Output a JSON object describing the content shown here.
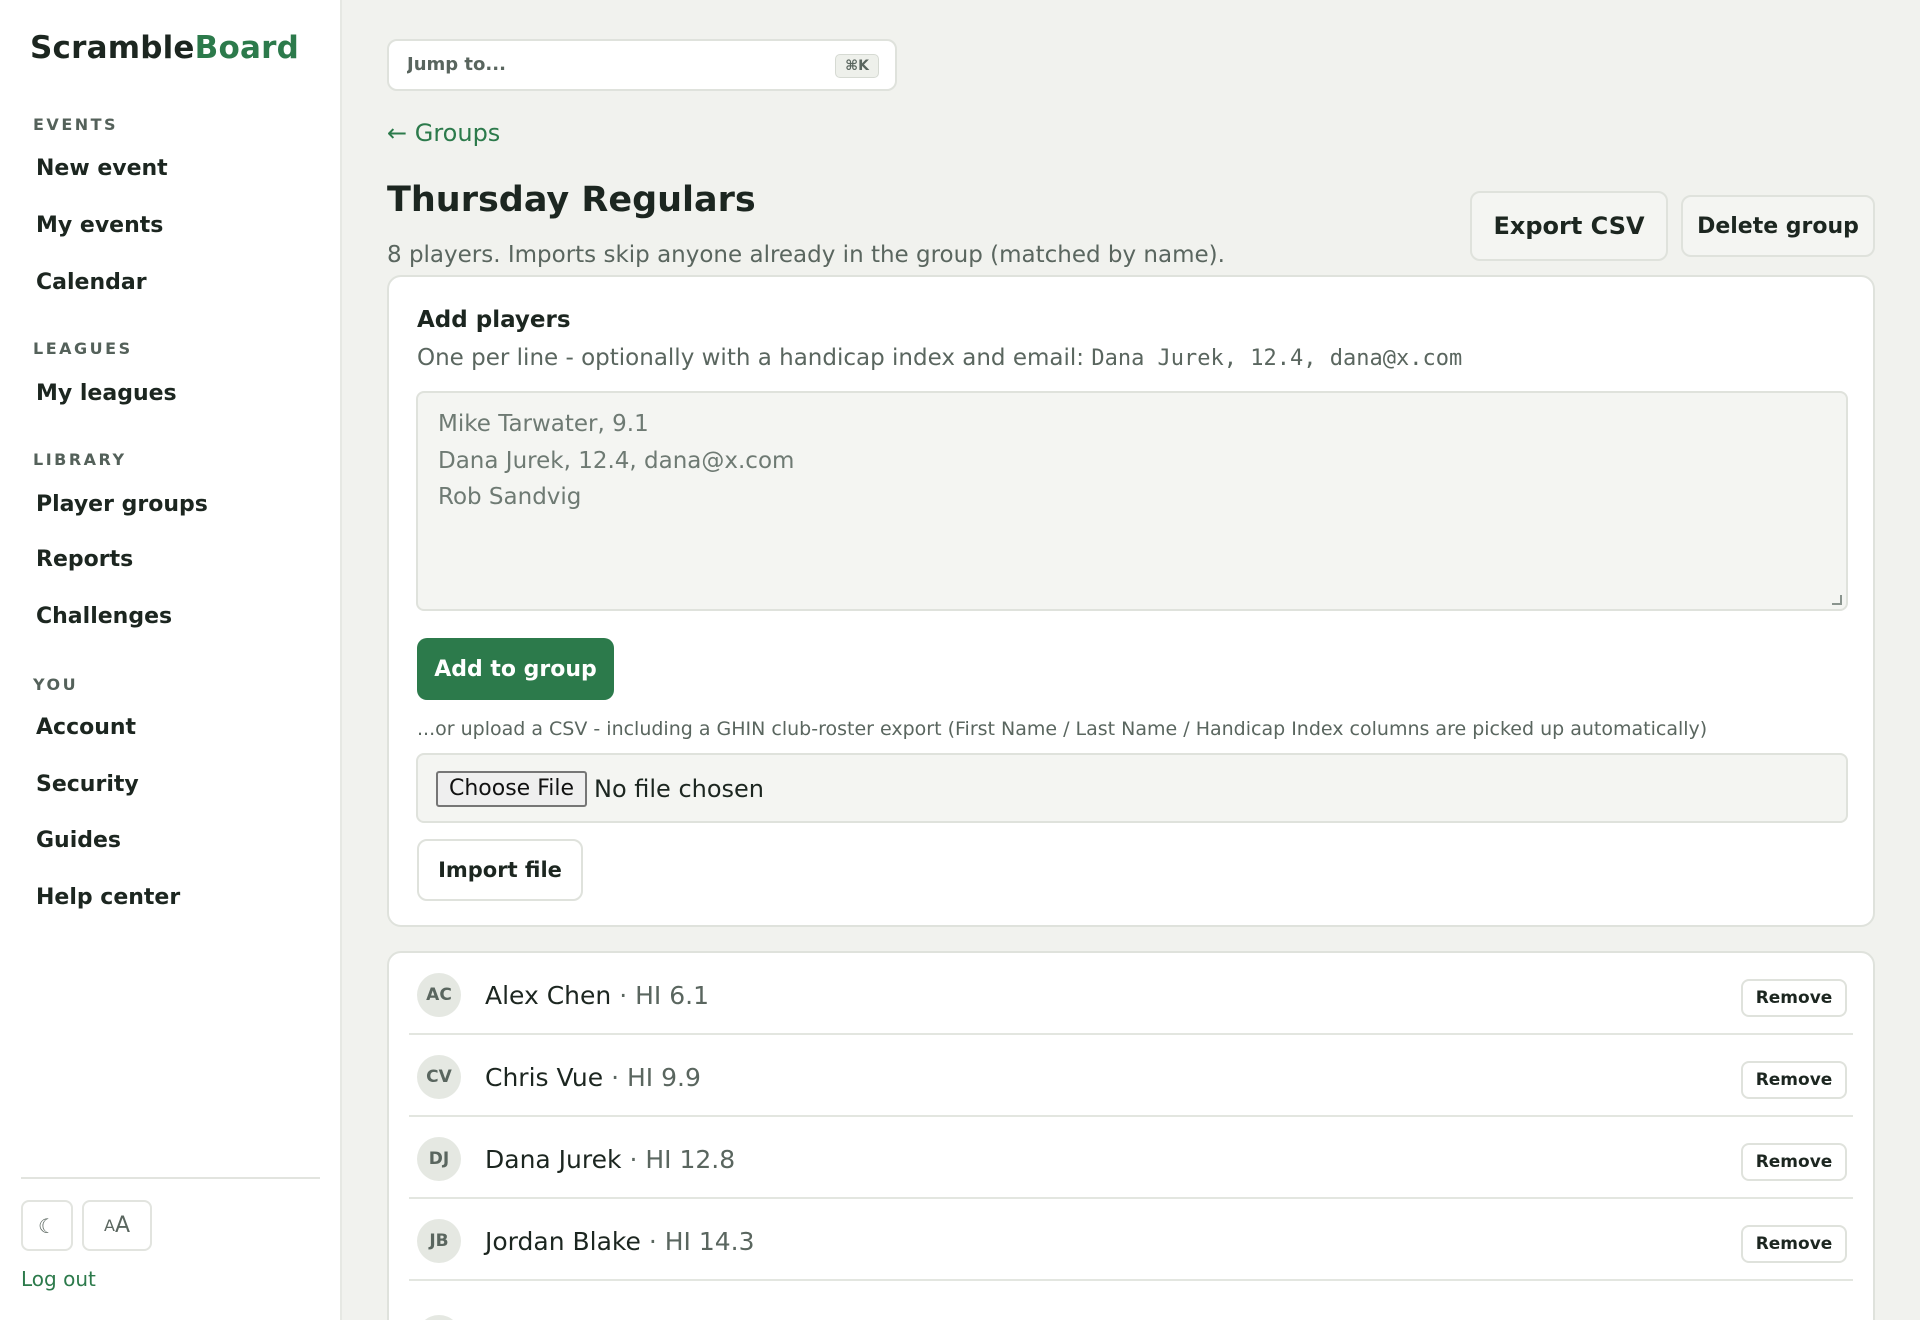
{
  "brand": {
    "part1": "Scramble",
    "part2": "Board"
  },
  "sidebar": {
    "sections": [
      {
        "label": "EVENTS",
        "items": [
          "New event",
          "My events",
          "Calendar"
        ]
      },
      {
        "label": "LEAGUES",
        "items": [
          "My leagues"
        ]
      },
      {
        "label": "LIBRARY",
        "items": [
          "Player groups",
          "Reports",
          "Challenges"
        ]
      },
      {
        "label": "YOU",
        "items": [
          "Account",
          "Security",
          "Guides",
          "Help center"
        ]
      }
    ],
    "theme_icon": "☾",
    "text_size_small": "A",
    "text_size_large": "A",
    "logout": "Log out"
  },
  "search": {
    "placeholder": "Jump to...",
    "shortcut": "⌘K"
  },
  "back_link": "← Groups",
  "group": {
    "title": "Thursday Regulars",
    "subtitle": "8 players. Imports skip anyone already in the group (matched by name).",
    "export_label": "Export CSV",
    "delete_label": "Delete group"
  },
  "add_players": {
    "title": "Add players",
    "help_prefix": "One per line - optionally with a handicap index and email: ",
    "help_example": "Dana Jurek, 12.4, dana@x.com",
    "placeholder_lines": [
      "Mike Tarwater, 9.1",
      "Dana Jurek, 12.4, dana@x.com",
      "Rob Sandvig"
    ],
    "add_button": "Add to group",
    "upload_note": "...or upload a CSV - including a GHIN club-roster export (First Name / Last Name / Handicap Index columns are picked up automatically)",
    "choose_file": "Choose File",
    "file_status": "No file chosen",
    "import_button": "Import file"
  },
  "players": [
    {
      "initials": "AC",
      "name": "Alex Chen",
      "hi": "· HI 6.1"
    },
    {
      "initials": "CV",
      "name": "Chris Vue",
      "hi": "· HI 9.9"
    },
    {
      "initials": "DJ",
      "name": "Dana Jurek",
      "hi": "· HI 12.8"
    },
    {
      "initials": "JB",
      "name": "Jordan Blake",
      "hi": "· HI 14.3"
    }
  ],
  "remove_label": "Remove"
}
